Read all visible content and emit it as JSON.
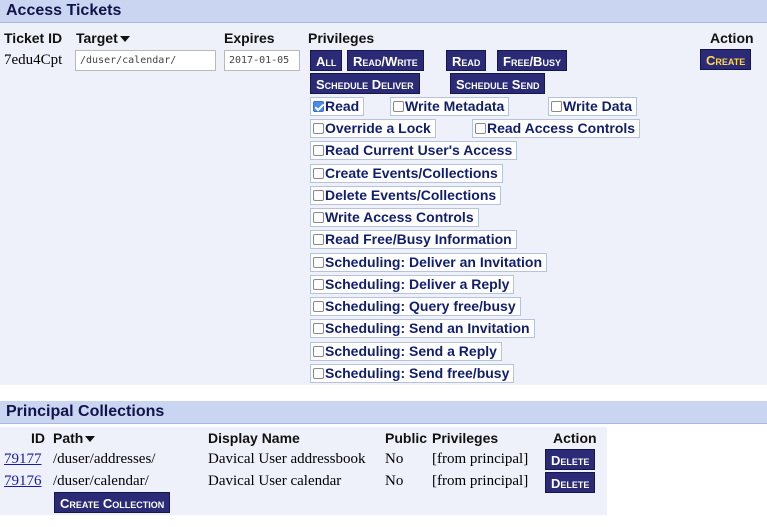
{
  "access_tickets": {
    "title": "Access Tickets",
    "headers": {
      "ticket_id": "Ticket ID",
      "target": "Target",
      "expires": "Expires",
      "privileges": "Privileges",
      "action": "Action"
    },
    "row": {
      "ticket_id": "7edu4Cpt",
      "target_value": "/duser/calendar/",
      "expires_value": "2017-01-05",
      "create_label": "Create"
    },
    "preset_buttons": [
      "All",
      "Read/Write",
      "Read",
      "Free/Busy",
      "Schedule Deliver",
      "Schedule Send"
    ],
    "privileges": [
      {
        "label": "Read",
        "checked": true
      },
      {
        "label": "Write Metadata",
        "checked": false
      },
      {
        "label": "Write Data",
        "checked": false
      },
      {
        "label": "Override a Lock",
        "checked": false
      },
      {
        "label": "Read Access Controls",
        "checked": false
      },
      {
        "label": "Read Current User's Access",
        "checked": false
      },
      {
        "label": "Create Events/Collections",
        "checked": false
      },
      {
        "label": "Delete Events/Collections",
        "checked": false
      },
      {
        "label": "Write Access Controls",
        "checked": false
      },
      {
        "label": "Read Free/Busy Information",
        "checked": false
      },
      {
        "label": "Scheduling: Deliver an Invitation",
        "checked": false
      },
      {
        "label": "Scheduling: Deliver a Reply",
        "checked": false
      },
      {
        "label": "Scheduling: Query free/busy",
        "checked": false
      },
      {
        "label": "Scheduling: Send an Invitation",
        "checked": false
      },
      {
        "label": "Scheduling: Send a Reply",
        "checked": false
      },
      {
        "label": "Scheduling: Send free/busy",
        "checked": false
      }
    ]
  },
  "principal_collections": {
    "title": "Principal Collections",
    "headers": {
      "id": "ID",
      "path": "Path",
      "display_name": "Display Name",
      "public": "Public",
      "privileges": "Privileges",
      "action": "Action"
    },
    "rows": [
      {
        "id": "79177",
        "path": "/duser/addresses/",
        "display_name": "Davical User addressbook",
        "public": "No",
        "privileges": "[from principal]",
        "action": "Delete"
      },
      {
        "id": "79176",
        "path": "/duser/calendar/",
        "display_name": "Davical User calendar",
        "public": "No",
        "privileges": "[from principal]",
        "action": "Delete"
      }
    ],
    "create_collection_label": "Create Collection"
  },
  "colors": {
    "header_bg": "#c9d5f1",
    "panel_bg": "#eef0fa",
    "button_bg": "#2a2a77",
    "create_text": "#ffd75a",
    "privilege_text": "#111d6e",
    "link": "#1a1aaa"
  },
  "icons": {
    "sort_indicator": "caret-down-icon",
    "checkbox": "checkbox-icon"
  }
}
